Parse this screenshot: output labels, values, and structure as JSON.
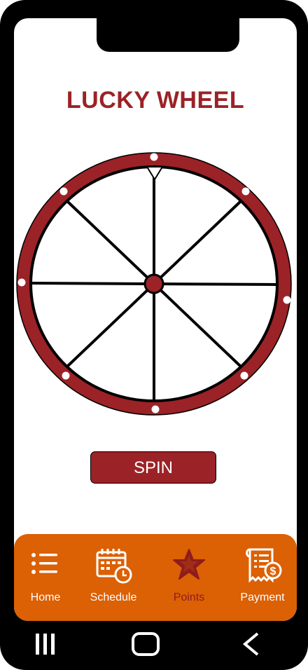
{
  "page": {
    "title": "LUCKY WHEEL"
  },
  "wheel": {
    "segments": 8
  },
  "spin": {
    "label": "SPIN"
  },
  "nav": {
    "items": [
      {
        "label": "Home",
        "icon": "list-icon"
      },
      {
        "label": "Schedule",
        "icon": "calendar-clock-icon"
      },
      {
        "label": "Points",
        "icon": "star-icon",
        "active": true
      },
      {
        "label": "Payment",
        "icon": "receipt-dollar-icon"
      }
    ]
  },
  "system_nav": {
    "icons": [
      "recent-apps-icon",
      "home-icon",
      "back-icon"
    ]
  },
  "colors": {
    "brand_red": "#9b2226",
    "nav_orange": "#dc6004",
    "active_label": "#8e1c1c",
    "frame": "#000000",
    "screen": "#ffffff"
  }
}
